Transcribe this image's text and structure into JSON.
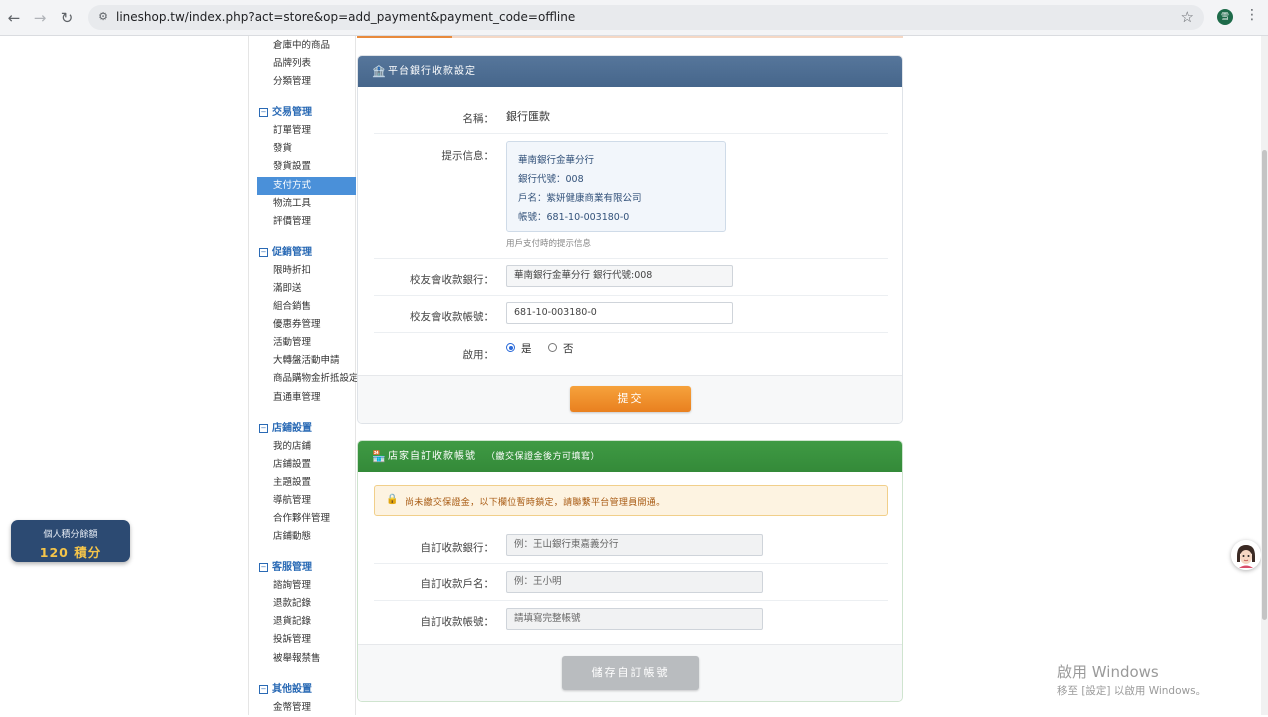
{
  "browser": {
    "url": "lineshop.tw/index.php?act=store&op=add_payment&payment_code=offline",
    "profile_initial": "雪"
  },
  "sidebar": {
    "top_items": [
      "倉庫中的商品",
      "品牌列表",
      "分類管理"
    ],
    "groups": [
      {
        "title": "交易管理",
        "items": [
          "訂單管理",
          "發貨",
          "發貨設置",
          "支付方式",
          "物流工具",
          "評價管理"
        ]
      },
      {
        "title": "促銷管理",
        "items": [
          "限時折扣",
          "滿即送",
          "組合銷售",
          "優惠券管理",
          "活動管理",
          "大轉盤活動申請",
          "商品購物金折抵設定",
          "直通車管理"
        ]
      },
      {
        "title": "店鋪設置",
        "items": [
          "我的店鋪",
          "店鋪設置",
          "主題設置",
          "導航管理",
          "合作夥伴管理",
          "店鋪動態"
        ]
      },
      {
        "title": "客服管理",
        "items": [
          "諮詢管理",
          "退款記錄",
          "退貨記錄",
          "投訴管理",
          "被舉報禁售"
        ]
      },
      {
        "title": "其他設置",
        "items": [
          "金幣管理"
        ]
      }
    ],
    "active_item": "支付方式"
  },
  "bank_panel": {
    "title": "平台銀行收款設定",
    "name_label": "名稱：",
    "name_value": "銀行匯款",
    "tip_label": "提示信息：",
    "tip_lines": [
      "華南銀行金華分行",
      "銀行代號：008",
      "戶名：紫妍健康商業有限公司",
      "帳號：681-10-003180-0"
    ],
    "tip_hint": "用戶支付時的提示信息",
    "bank_label": "校友會收款銀行：",
    "bank_value": "華南銀行金華分行 銀行代號:008",
    "account_label": "校友會收款帳號：",
    "account_value": "681-10-003180-0",
    "enable_label": "啟用：",
    "enable_yes": "是",
    "enable_no": "否",
    "submit_label": "提交"
  },
  "custom_panel": {
    "title": "店家自訂收款帳號",
    "note": "（繳交保證金後方可填寫）",
    "warning": "尚未繳交保證金，以下欄位暫時鎖定，請聯繫平台管理員開通。",
    "bank_label": "自訂收款銀行：",
    "bank_placeholder": "例：王山銀行東嘉義分行",
    "holder_label": "自訂收款戶名：",
    "holder_placeholder": "例：王小明",
    "account_label": "自訂收款帳號：",
    "account_placeholder": "請填寫完整帳號",
    "save_label": "儲存自訂帳號"
  },
  "points": {
    "label": "個人積分餘額",
    "value": "120 積分"
  },
  "watermark": {
    "line1": "啟用 Windows",
    "line2": "移至 [設定] 以啟用 Windows。"
  }
}
